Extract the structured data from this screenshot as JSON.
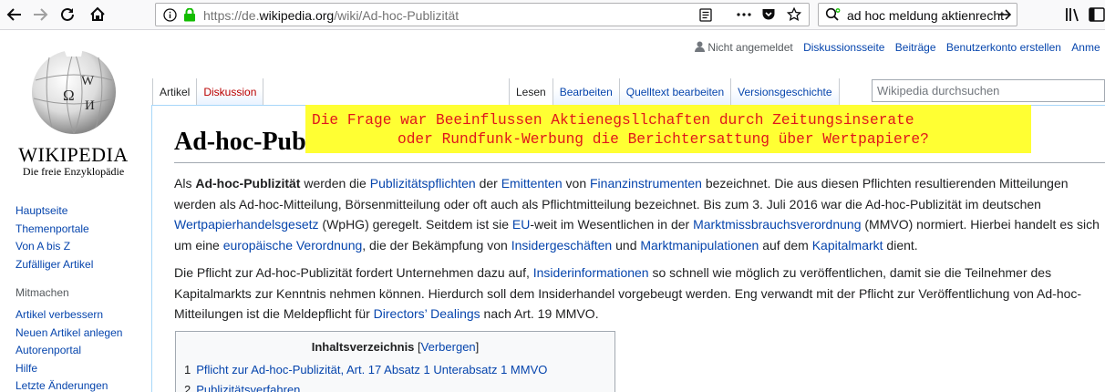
{
  "browser": {
    "url_prefix": "https://de.",
    "url_domain": "wikipedia.org",
    "url_path": "/wiki/Ad-hoc-Publizität",
    "search_query": "ad hoc meldung aktienrecht"
  },
  "personal": {
    "status": "Nicht angemeldet",
    "links": [
      "Diskussionsseite",
      "Beiträge",
      "Benutzerkonto erstellen",
      "Anme"
    ]
  },
  "logo": {
    "wordmark": "WIKIPEDIA",
    "tagline": "Die freie Enzyklopädie",
    "globe_glyphs": [
      "Ω",
      "W",
      "И"
    ]
  },
  "sidebar": {
    "nav": [
      "Hauptseite",
      "Themenportale",
      "Von A bis Z",
      "Zufälliger Artikel"
    ],
    "mitmachen_title": "Mitmachen",
    "mitmachen": [
      "Artikel verbessern",
      "Neuen Artikel anlegen",
      "Autorenportal",
      "Hilfe",
      "Letzte Änderungen"
    ]
  },
  "tabs": {
    "left": [
      "Artikel",
      "Diskussion"
    ],
    "right": [
      "Lesen",
      "Bearbeiten",
      "Quelltext bearbeiten",
      "Versionsgeschichte"
    ]
  },
  "wiki_search": {
    "placeholder": "Wikipedia durchsuchen"
  },
  "overlay": {
    "line1": "Die Frage war Beeinflussen Aktienegsllchaften durch Zeitungsinserate",
    "line2": "oder Rundfunk-Werbung die Berichtersattung über Wertpapiere?"
  },
  "article": {
    "title": "Ad-hoc-Publizität",
    "p1": {
      "l1": [
        "Als ",
        "Ad-hoc-Publizität",
        " werden die ",
        "Publizitätspflichten",
        " der ",
        "Emittenten",
        " von ",
        "Finanzinstrumenten",
        " bezeichnet. Die aus diesen Pflichten resultierenden Mitteilungen"
      ],
      "l2": "werden als Ad-hoc-Mitteilung, Börsenmitteilung oder oft auch als Pflichtmitteilung bezeichnet. Bis zum 3. Juli 2016 war die Ad-hoc-Publizität im deutschen",
      "l3": [
        "Wertpapierhandelsgesetz",
        " (WpHG) geregelt. Seitdem ist sie ",
        "EU",
        "-weit im Wesentlichen in der ",
        "Marktmissbrauchsverordnung",
        " (MMVO) normiert. Hierbei handelt es sich"
      ],
      "l4": [
        "um eine ",
        "europäische Verordnung",
        ", die der Bekämpfung von ",
        "Insidergeschäften",
        " und ",
        "Marktmanipulationen",
        " auf dem ",
        "Kapitalmarkt",
        " dient."
      ]
    },
    "p2": {
      "l1": [
        "Die Pflicht zur Ad-hoc-Publizität fordert Unternehmen dazu auf, ",
        "Insiderinformationen",
        " so schnell wie möglich zu veröffentlichen, damit sie die Teilnehmer des"
      ],
      "l2": "Kapitalmarkts zur Kenntnis nehmen können. Hierdurch soll dem Insiderhandel vorgebeugt werden. Eng verwandt mit der Pflicht zur Veröffentlichung von Ad-hoc-",
      "l3": [
        "Mitteilungen ist die Meldepflicht für ",
        "Directors’ Dealings",
        " nach Art. 19 MMVO."
      ]
    }
  },
  "toc": {
    "title": "Inhaltsverzeichnis",
    "toggle": "Verbergen",
    "items": [
      {
        "num": "1",
        "text": "Pflicht zur Ad-hoc-Publizität, Art. 17 Absatz 1 Unterabsatz 1 MMVO"
      },
      {
        "num": "2",
        "text": "Publizitätsverfahren"
      }
    ]
  }
}
